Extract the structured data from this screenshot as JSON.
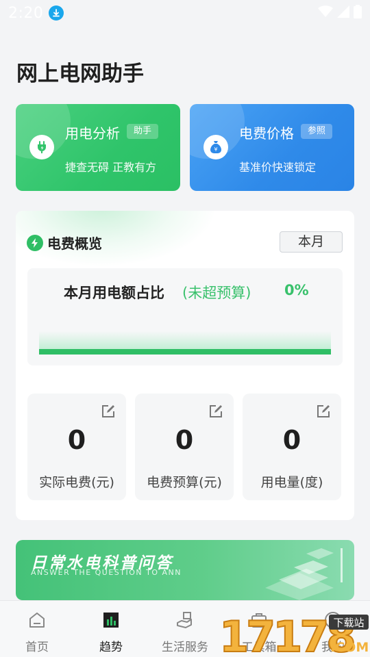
{
  "status_bar": {
    "time": "2:20"
  },
  "page_title": "网上电网助手",
  "cards": [
    {
      "title": "用电分析",
      "tag": "助手",
      "subtitle": "捷查无碍 正教有方"
    },
    {
      "title": "电费价格",
      "tag": "参照",
      "subtitle": "基准价快速锁定"
    }
  ],
  "overview": {
    "title": "电费概览",
    "period_button": "本月",
    "ratio_label": "本月用电额占比",
    "ratio_state": "(未超预算)",
    "ratio_percent": "0%",
    "ratio_value": 0,
    "stats": [
      {
        "value": "0",
        "label": "实际电费(元)"
      },
      {
        "value": "0",
        "label": "电费预算(元)"
      },
      {
        "value": "0",
        "label": "用电量(度)"
      }
    ]
  },
  "banner": {
    "title": "日常水电科普问答",
    "subtitle": "ANSWER THE QUESTION TO ANN"
  },
  "tabbar": [
    {
      "label": "首页",
      "icon": "home-icon"
    },
    {
      "label": "趋势",
      "icon": "chart-icon"
    },
    {
      "label": "生活服务",
      "icon": "service-icon"
    },
    {
      "label": "工具箱",
      "icon": "toolbox-icon"
    },
    {
      "label": "我的",
      "icon": "profile-icon"
    }
  ],
  "watermark": {
    "text": "17178",
    "sub": "下载站",
    "domain": ".COM"
  },
  "colors": {
    "green": "#2fbe65",
    "blue": "#2f8ae9",
    "text": "#222222"
  }
}
